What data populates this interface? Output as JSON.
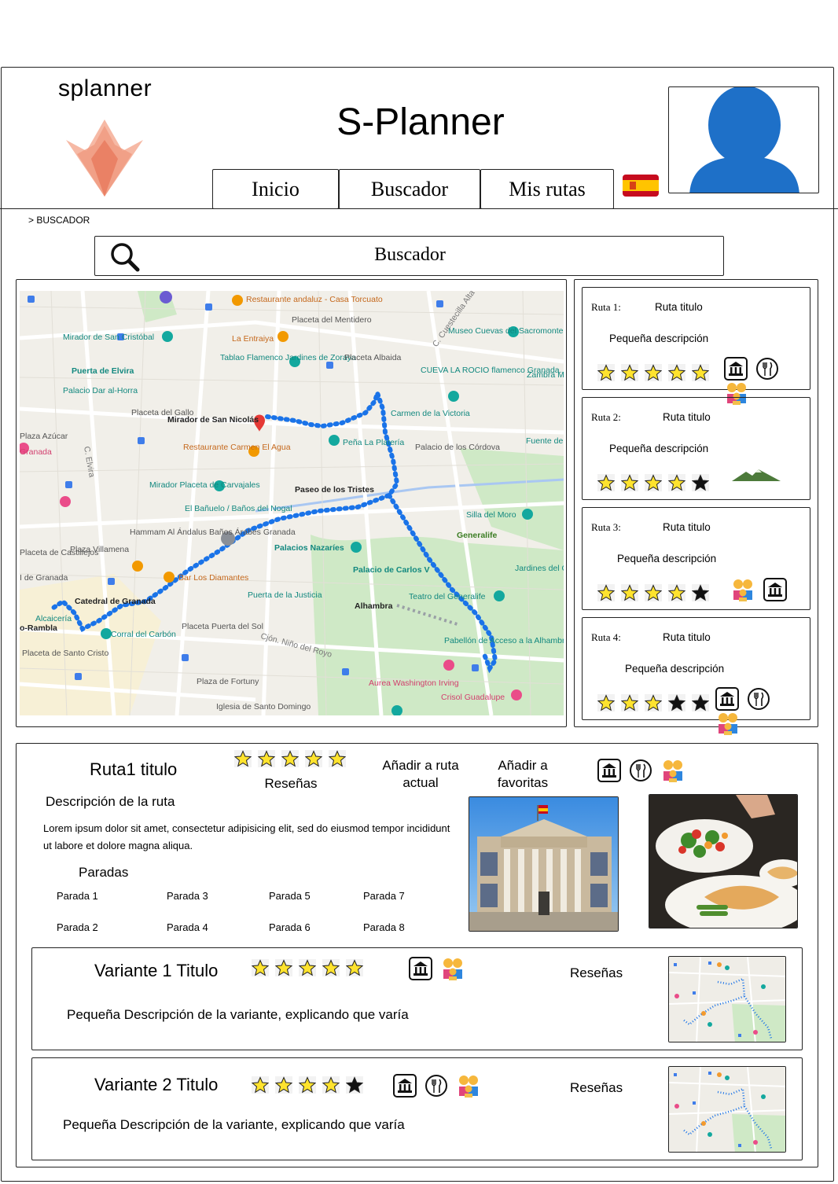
{
  "app": {
    "logo_text": "splanner",
    "title": "S-Planner"
  },
  "nav": {
    "items": [
      {
        "label": "Inicio"
      },
      {
        "label": "Buscador"
      },
      {
        "label": "Mis rutas"
      }
    ],
    "language_flag": "🇪🇸"
  },
  "breadcrumb": "> BUSCADOR",
  "search": {
    "placeholder": "Buscador"
  },
  "map": {
    "labels": [
      "Restaurante andaluz - Casa Torcuato",
      "Placeta del Mentidero",
      "Museo Cuevas del Sacromonte",
      "Mirador de San Cristóbal",
      "La Entraiya",
      "Tablao Flamenco Jardines de Zoraya",
      "Placeta Albaida",
      "Puerta de Elvira",
      "CUEVA LA ROCIO flamenco Granada...",
      "Zambra M La Canas",
      "Palacio Dar al-Horra",
      "Placeta del Gallo",
      "Mirador de San Nicolás",
      "Carmen de la Victoria",
      "Plaza Azúcar",
      "Peña La Platería",
      "Palacio de los Córdova",
      "Fuente de",
      "Granada",
      "Restaurante Carmen El Agua",
      "Mirador Placeta de Carvajales",
      "Paseo de los Tristes",
      "El Bañuelo / Baños del Nogal",
      "Silla del Moro",
      "Hammam Al Ándalus Baños Árabes Granada",
      "Generalife",
      "Placeta de Castillejos",
      "Plaza Villamena",
      "Palacios Nazaríes",
      "Jardines del Gen Palacio de",
      "I de Granada",
      "Bar Los Diamantes",
      "Palacio de Carlos V",
      "Puerta de la Justicia",
      "Teatro del Generalife",
      "Catedral de Granada",
      "Alhambra",
      "Alcaicería",
      "o-Rambla",
      "Corral del Carbón",
      "Placeta Puerta del Sol",
      "Cjón. Niño del Royo",
      "Pabellón de Acceso a la Alhambra",
      "Placeta de Santo Cristo",
      "Plaza de Fortuny",
      "Aurea Washington Irving",
      "Crisol Guadalupe",
      "Iglesia de Santo Domingo",
      "C. Cuestecilla Alta",
      "C. Elvira"
    ]
  },
  "route_cards": [
    {
      "num": "Ruta 1:",
      "title": "Ruta titulo",
      "desc": "Pequeña descripción",
      "stars": 5,
      "icons": [
        "museum-icon",
        "restaurant-icon",
        "family-icon"
      ]
    },
    {
      "num": "Ruta 2:",
      "title": "Ruta titulo",
      "desc": "Pequeña descripción",
      "stars": 4,
      "icons": [
        "mountain-icon"
      ]
    },
    {
      "num": "Ruta 3:",
      "title": "Ruta titulo",
      "desc": "Pequeña descripción",
      "stars": 4,
      "icons": [
        "family-icon",
        "museum-icon"
      ]
    },
    {
      "num": "Ruta 4:",
      "title": "Ruta titulo",
      "desc": "Pequeña descripción",
      "stars": 3,
      "icons": [
        "museum-icon",
        "restaurant-icon",
        "family-icon"
      ]
    }
  ],
  "detail": {
    "title": "Ruta1 titulo",
    "stars": 5,
    "reviews_label": "Reseñas",
    "add_current_label": "Añadir a ruta actual",
    "add_favorites_label": "Añadir a favoritas",
    "description_heading": "Descripción de la ruta",
    "description_text": "Lorem ipsum dolor sit amet, consectetur adipisicing elit, sed do eiusmod tempor incididunt ut labore et dolore magna aliqua.",
    "stops_heading": "Paradas",
    "stops": [
      "Parada 1",
      "Parada 2",
      "Parada 3",
      "Parada 4",
      "Parada 5",
      "Parada 6",
      "Parada 7",
      "Parada 8"
    ]
  },
  "variants": [
    {
      "title": "Variante 1 Titulo",
      "stars": 5,
      "desc": "Pequeña Descripción de la variante, explicando que varía",
      "reviews_label": "Reseñas"
    },
    {
      "title": "Variante 2 Titulo",
      "stars": 4,
      "desc": "Pequeña Descripción de la variante, explicando que varía",
      "reviews_label": "Reseñas"
    }
  ],
  "colors": {
    "star_fill": "#FFE32E",
    "route_blue": "#1A73E8",
    "avatar_blue": "#1E70C8",
    "logo_orange": "#F08060"
  }
}
